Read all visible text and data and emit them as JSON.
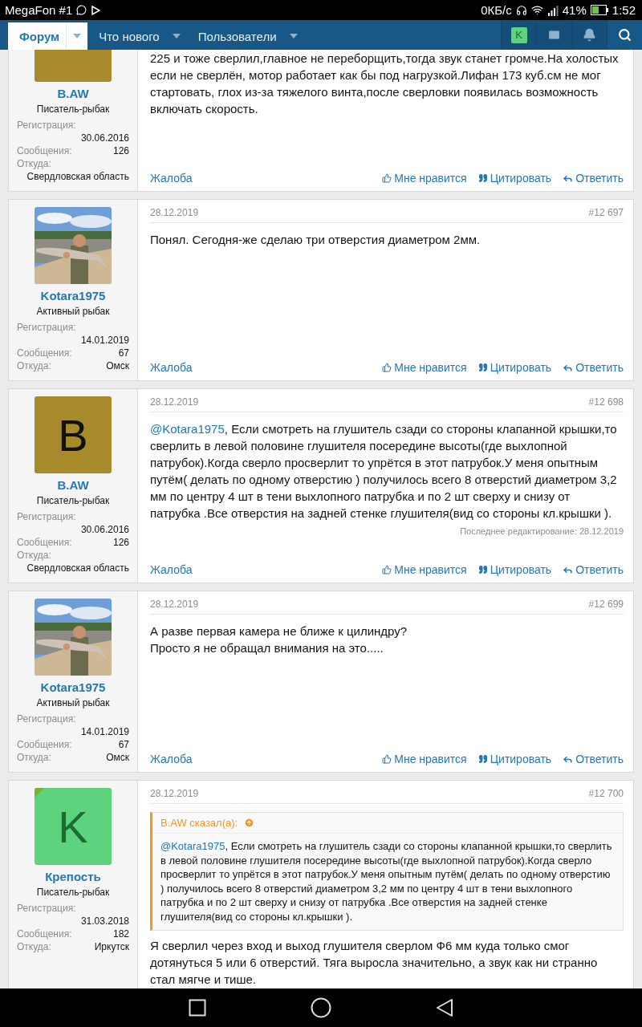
{
  "status_bar": {
    "carrier": "MegaFon #1",
    "speed": "0КБ/с",
    "battery": "41%",
    "time": "1:52"
  },
  "nav": {
    "tabs": [
      {
        "label": "Форум",
        "selected": true
      },
      {
        "label": "Что нового",
        "selected": false
      },
      {
        "label": "Пользователи",
        "selected": false
      }
    ],
    "user_initial": "K"
  },
  "posts": [
    {
      "clipped": true,
      "author": {
        "name": "B.AW",
        "title": "Писатель-рыбак",
        "avatar": {
          "kind": "letter",
          "color": "#a68a2b"
        },
        "stats": [
          {
            "label": "Регистрация:",
            "value": "30.06.2016"
          },
          {
            "label": "Сообщения:",
            "value": "126"
          },
          {
            "label": "Откуда:",
            "value": "Свердловская область"
          }
        ]
      },
      "paragraphs": [
        {
          "text": "225 и тоже сверлил,главное не переборщить,тогда звук станет громче.На холостых если не сверлён, мотор работает как бы под нагрузкой.Лифан 173 куб.см не мог стартовать, глох из-за тяжелого винта,после сверловки появилась возможность включать скорость."
        }
      ],
      "actions": {
        "report": "Жалоба",
        "like": "Мне нравится",
        "quote": "Цитировать",
        "reply": "Ответить"
      }
    },
    {
      "clipped": false,
      "author": {
        "name": "Kotara1975",
        "title": "Активный рыбак",
        "stats": [
          {
            "label": "Регистрация:",
            "value": "14.01.2019"
          },
          {
            "label": "Сообщения:",
            "value": "67"
          },
          {
            "label": "Откуда:",
            "value": "Омск"
          }
        ]
      },
      "date": "28.12.2019",
      "number": "#12 697",
      "paragraphs": [
        {
          "text": "Понял. Сегодня-же сделаю три отверстия диаметром 2мм."
        }
      ],
      "actions": {
        "report": "Жалоба",
        "like": "Мне нравится",
        "quote": "Цитировать",
        "reply": "Ответить"
      }
    },
    {
      "clipped": false,
      "author": {
        "name": "B.AW",
        "title": "Писатель-рыбак",
        "avatar": {
          "kind": "letter",
          "letter": "B",
          "color": "#a68a2b"
        },
        "stats": [
          {
            "label": "Регистрация:",
            "value": "30.06.2016"
          },
          {
            "label": "Сообщения:",
            "value": "126"
          },
          {
            "label": "Откуда:",
            "value": "Свердловская область"
          }
        ]
      },
      "date": "28.12.2019",
      "number": "#12 698",
      "paragraphs": [
        {
          "mention": "@Kotara1975",
          "text": ", Если смотреть на глушитель сзади со стороны клапанной крышки,то сверлить в левой половине глушителя посередине высоты(где выхлопной патрубок).Когда сверло просверлит то упрётся в этот патрубок.У меня опытным путём( делать по одному отверстию ) получилось всего 8 отверстий диаметром 3,2 мм по центру 4 шт в тени выхлопного патрубка и по 2 шт сверху и снизу от патрубка .Все отверстия на задней стенке глушителя(вид со стороны кл.крышки )."
        }
      ],
      "edited": "Последнее редактирование: 28.12.2019",
      "actions": {
        "report": "Жалоба",
        "like": "Мне нравится",
        "quote": "Цитировать",
        "reply": "Ответить"
      }
    },
    {
      "clipped": false,
      "author": {
        "name": "Kotara1975",
        "title": "Активный рыбак",
        "stats": [
          {
            "label": "Регистрация:",
            "value": "14.01.2019"
          },
          {
            "label": "Сообщения:",
            "value": "67"
          },
          {
            "label": "Откуда:",
            "value": "Омск"
          }
        ]
      },
      "date": "28.12.2019",
      "number": "#12 699",
      "paragraphs": [
        {
          "text": "А разве первая камера не ближе к цилиндру?"
        },
        {
          "text": "Просто я не обращал внимания на это....."
        }
      ],
      "actions": {
        "report": "Жалоба",
        "like": "Мне нравится",
        "quote": "Цитировать",
        "reply": "Ответить"
      }
    },
    {
      "clipped": false,
      "author": {
        "name": "Крепость",
        "title": "Писатель-рыбак",
        "avatar": {
          "kind": "letter",
          "letter": "K",
          "color": "#5cd37c",
          "online": true
        },
        "stats": [
          {
            "label": "Регистрация:",
            "value": "31.03.2018"
          },
          {
            "label": "Сообщения:",
            "value": "182"
          },
          {
            "label": "Откуда:",
            "value": "Иркутск"
          }
        ]
      },
      "date": "28.12.2019",
      "number": "#12 700",
      "quote": {
        "author": "B.AW сказал(а):",
        "mention": "@Kotara1975",
        "text": ", Если смотреть на глушитель сзади со стороны клапанной крышки,то сверлить в левой половине глушителя посередине высоты(где выхлопной патрубок).Когда сверло просверлит то упрётся в этот патрубок.У меня опытным путём( делать по одному отверстию ) получилось всего 8 отверстий диаметром 3,2 мм по центру 4 шт в тени выхлопного патрубка и по 2 шт сверху и снизу от патрубка .Все отверстия на задней стенке глушителя(вид со стороны кл.крышки )."
      },
      "paragraphs": [
        {
          "text": "Я сверлил через вход и выход глушителя сверлом Ф6 мм куда только смог дотянуться 5 или 6 отверстий. Тяга выросла значительно, а звук как ни странно стал мягче и тише."
        }
      ]
    }
  ]
}
